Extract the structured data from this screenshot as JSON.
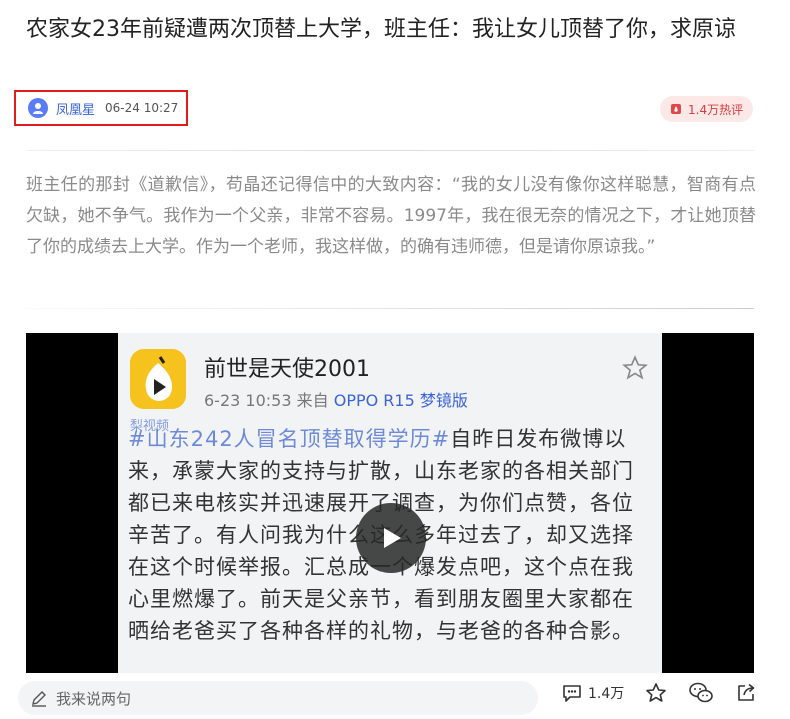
{
  "article": {
    "title": "农家女23年前疑遭两次顶替上大学，班主任：我让女儿顶替了你，求原谅",
    "author": "凤凰星",
    "time": "06-24 10:27",
    "hot_label": "1.4万热评",
    "paragraph": "班主任的那封《道歉信》，苟晶还记得信中的大致内容：“我的女儿没有像你这样聪慧，智商有点欠缺，她不争气。我作为一个父亲，非常不容易。1997年，我在很无奈的情况之下，才让她顶替了你的成绩去上大学。作为一个老师，我这样做，的确有违师德，但是请你原谅我。”"
  },
  "video": {
    "weibo_user": "前世是天使2001",
    "weibo_time": "6-23 10:53",
    "weibo_from": "来自",
    "weibo_device": "OPPO R15 梦镜版",
    "watermark": "梨视频",
    "hashtag": "#山东242人冒名顶替取得学历#",
    "body": "自昨日发布微博以来，承蒙大家的支持与扩散，山东老家的各相关部门都已来电核实并迅速展开了调查，为你们点赞，各位辛苦了。有人问我为什么这么多年过去了，却又选择在这个时候举报。汇总成一个爆发点吧，这个点在我心里燃爆了。前天是父亲节，看到朋友圈里大家都在晒给老爸买了各种各样的礼物，与老爸的各种合影。"
  },
  "bottom_bar": {
    "comment_placeholder": "我来说两句",
    "comment_count": "1.4万"
  },
  "colors": {
    "accent_blue": "#3a64d8",
    "highlight_border": "#e21b1b",
    "hot_text": "#d83b3b"
  }
}
